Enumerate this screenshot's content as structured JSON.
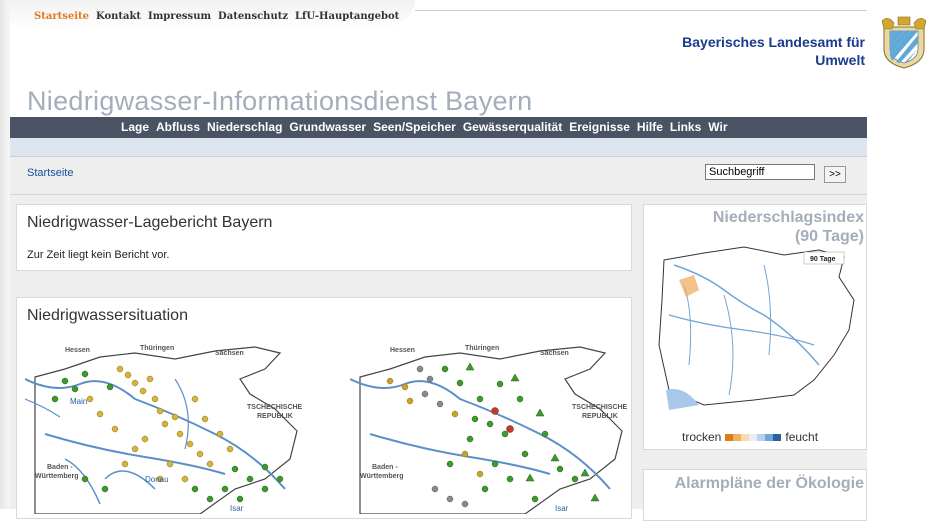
{
  "top_nav": {
    "items": [
      {
        "label": "Startseite",
        "active": true
      },
      {
        "label": "Kontakt"
      },
      {
        "label": "Impressum"
      },
      {
        "label": "Datenschutz"
      },
      {
        "label": "LfU-Hauptangebot"
      }
    ]
  },
  "agency": {
    "line1": "Bayerisches Landesamt für",
    "line2": "Umwelt"
  },
  "site_title": "Niedrigwasser-Informationsdienst Bayern",
  "main_nav": [
    "Lage",
    "Abfluss",
    "Niederschlag",
    "Grundwasser",
    "Seen/Speicher",
    "Gewässerqualität",
    "Ereignisse",
    "Hilfe",
    "Links",
    "Wir"
  ],
  "breadcrumb": "Startseite",
  "search": {
    "value": "Suchbegriff",
    "button": ">>"
  },
  "report_box": {
    "title": "Niedrigwasser-Lagebericht Bayern",
    "text": "Zur Zeit liegt kein Bericht vor."
  },
  "situation_box": {
    "title": "Niedrigwassersituation",
    "map_labels": {
      "hessen": "Hessen",
      "thueringen": "Thüringen",
      "sachsen": "Sachsen",
      "tschech1": "TSCHECHISCHE",
      "tschech2": "REPUBLIK",
      "baden1": "Baden -",
      "baden2": "Württemberg",
      "main": "Main",
      "donau": "Donau",
      "isar": "Isar"
    }
  },
  "precip_box": {
    "title1": "Niederschlagsindex",
    "title2": "(90 Tage)",
    "period": "90 Tage",
    "legend_dry": "trocken",
    "legend_wet": "feucht"
  },
  "alarm_box": {
    "title": "Alarmpläne der Ökologie"
  },
  "colors": {
    "nav_bg": "#4a5364",
    "title_grey": "#a4adba",
    "active_orange": "#e07b1a",
    "agency_blue": "#1a3a8c"
  }
}
